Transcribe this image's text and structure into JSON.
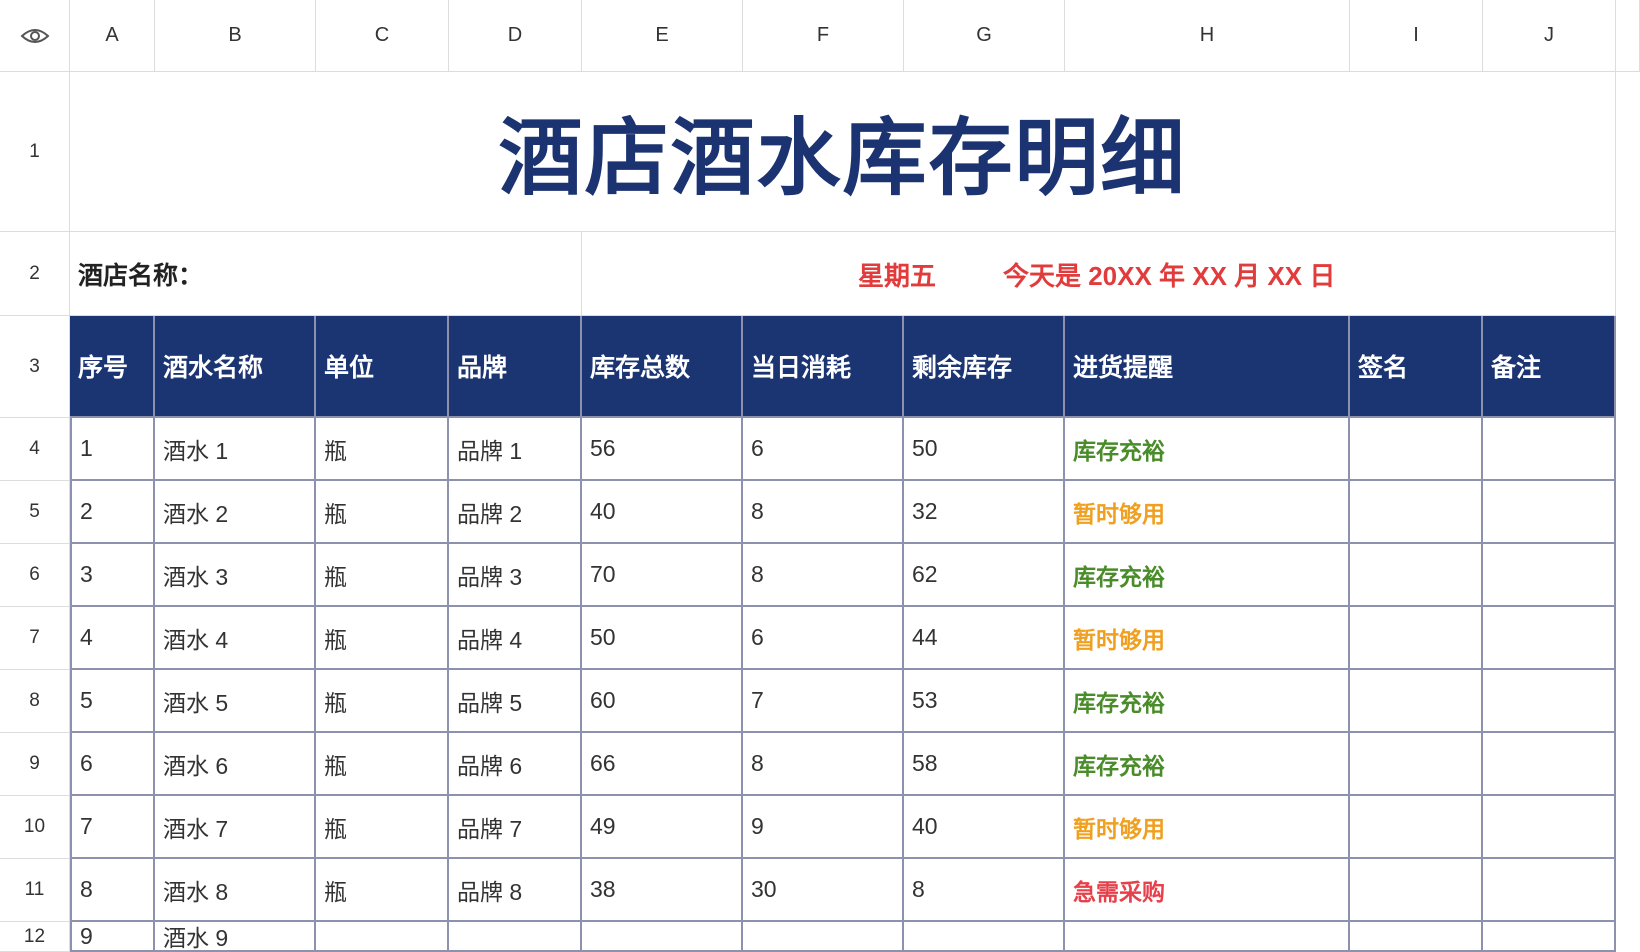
{
  "columns": [
    "A",
    "B",
    "C",
    "D",
    "E",
    "F",
    "G",
    "H",
    "I",
    "J"
  ],
  "rows": [
    "1",
    "2",
    "3",
    "4",
    "5",
    "6",
    "7",
    "8",
    "9",
    "10",
    "11",
    "12"
  ],
  "corner_icon": "eye-icon",
  "freeze_icon": "freeze-columns-icon",
  "title": "酒店酒水库存明细",
  "hotel_name_label": "酒店名称：",
  "weekday": "星期五",
  "today": "今天是 20XX 年 XX 月 XX 日",
  "colors": {
    "title": "#1c3372",
    "header_bg": "#1b3472",
    "header_text": "#ffffff",
    "red": "#e23b3b",
    "green": "#4a8c2a",
    "orange": "#f0a020",
    "urgent": "#e8404a",
    "grid": "#8d91ad"
  },
  "table": {
    "headers": [
      "序号",
      "酒水名称",
      "单位",
      "品牌",
      "库存总数",
      "当日消耗",
      "剩余库存",
      "进货提醒",
      "签名",
      "备注"
    ],
    "rows": [
      [
        "1",
        "酒水 1",
        "瓶",
        "品牌 1",
        "56",
        "6",
        "50",
        "库存充裕",
        "",
        ""
      ],
      [
        "2",
        "酒水 2",
        "瓶",
        "品牌 2",
        "40",
        "8",
        "32",
        "暂时够用",
        "",
        ""
      ],
      [
        "3",
        "酒水 3",
        "瓶",
        "品牌 3",
        "70",
        "8",
        "62",
        "库存充裕",
        "",
        ""
      ],
      [
        "4",
        "酒水 4",
        "瓶",
        "品牌 4",
        "50",
        "6",
        "44",
        "暂时够用",
        "",
        ""
      ],
      [
        "5",
        "酒水 5",
        "瓶",
        "品牌 5",
        "60",
        "7",
        "53",
        "库存充裕",
        "",
        ""
      ],
      [
        "6",
        "酒水 6",
        "瓶",
        "品牌 6",
        "66",
        "8",
        "58",
        "库存充裕",
        "",
        ""
      ],
      [
        "7",
        "酒水 7",
        "瓶",
        "品牌 7",
        "49",
        "9",
        "40",
        "暂时够用",
        "",
        ""
      ],
      [
        "8",
        "酒水 8",
        "瓶",
        "品牌 8",
        "38",
        "30",
        "8",
        "急需采购",
        "",
        ""
      ],
      [
        "9",
        "酒水 9",
        "",
        "",
        "",
        "",
        "",
        "",
        "",
        ""
      ]
    ],
    "reminder_status": [
      "plenty",
      "enough",
      "plenty",
      "enough",
      "plenty",
      "plenty",
      "enough",
      "urgent",
      ""
    ]
  }
}
